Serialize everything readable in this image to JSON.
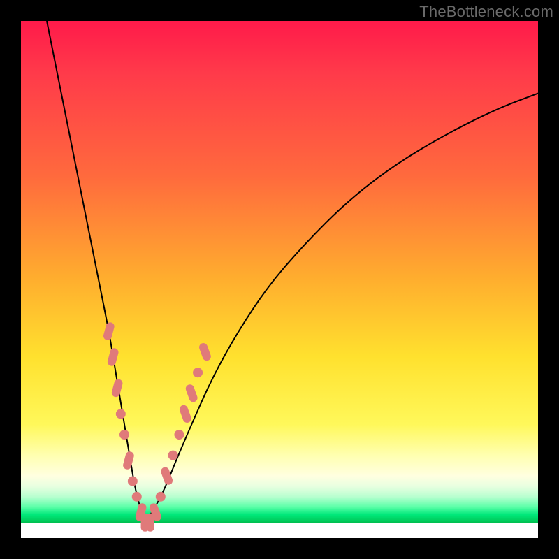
{
  "watermark": "TheBottleneck.com",
  "colors": {
    "bead": "#e07a7a",
    "curve": "#000000",
    "frame": "#000000"
  },
  "chart_data": {
    "type": "line",
    "title": "",
    "xlabel": "",
    "ylabel": "",
    "xlim": [
      0,
      100
    ],
    "ylim": [
      0,
      100
    ],
    "grid": false,
    "legend": false,
    "description": "Bottleneck-style V-curve: two branches descending from the top that meet at a minimum near x≈24, y≈3, over a heatmap gradient from red (top) through yellow to a narrow green band near the bottom.",
    "series": [
      {
        "name": "left-branch",
        "x": [
          5,
          7,
          9,
          11,
          13,
          15,
          17,
          18,
          19,
          20,
          21,
          22,
          23,
          24
        ],
        "y": [
          100,
          90,
          80,
          70,
          60,
          50,
          40,
          34,
          28,
          22,
          16,
          10,
          6,
          3
        ]
      },
      {
        "name": "right-branch",
        "x": [
          24,
          26,
          28,
          30,
          33,
          37,
          42,
          48,
          55,
          63,
          72,
          82,
          92,
          100
        ],
        "y": [
          3,
          6,
          10,
          15,
          22,
          31,
          40,
          49,
          57,
          65,
          72,
          78,
          83,
          86
        ]
      }
    ],
    "beads": {
      "note": "Highlighted points near the minimum, drawn as rounded pink markers along both branches",
      "points": [
        {
          "x": 17.0,
          "y": 40,
          "shape": "pill"
        },
        {
          "x": 17.8,
          "y": 35,
          "shape": "pill"
        },
        {
          "x": 18.6,
          "y": 29,
          "shape": "pill"
        },
        {
          "x": 19.3,
          "y": 24,
          "shape": "dot"
        },
        {
          "x": 20.0,
          "y": 20,
          "shape": "dot"
        },
        {
          "x": 20.8,
          "y": 15,
          "shape": "pill"
        },
        {
          "x": 21.6,
          "y": 11,
          "shape": "dot"
        },
        {
          "x": 22.4,
          "y": 8,
          "shape": "dot"
        },
        {
          "x": 23.2,
          "y": 5,
          "shape": "pill"
        },
        {
          "x": 24.0,
          "y": 3,
          "shape": "pill"
        },
        {
          "x": 25.0,
          "y": 3,
          "shape": "pill"
        },
        {
          "x": 26.0,
          "y": 5,
          "shape": "pill"
        },
        {
          "x": 27.0,
          "y": 8,
          "shape": "dot"
        },
        {
          "x": 28.2,
          "y": 12,
          "shape": "pill"
        },
        {
          "x": 29.4,
          "y": 16,
          "shape": "dot"
        },
        {
          "x": 30.6,
          "y": 20,
          "shape": "dot"
        },
        {
          "x": 31.8,
          "y": 24,
          "shape": "pill"
        },
        {
          "x": 33.0,
          "y": 28,
          "shape": "pill"
        },
        {
          "x": 34.2,
          "y": 32,
          "shape": "dot"
        },
        {
          "x": 35.6,
          "y": 36,
          "shape": "pill"
        }
      ]
    }
  }
}
